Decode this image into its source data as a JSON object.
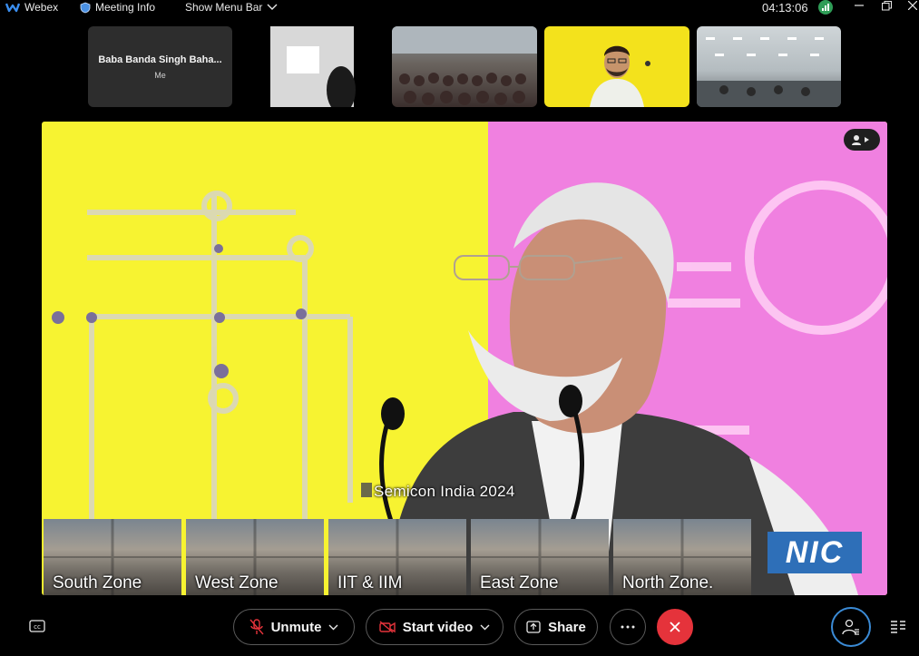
{
  "topbar": {
    "app_name": "Webex",
    "meeting_info_label": "Meeting Info",
    "menu_bar_label": "Show Menu Bar",
    "time": "04:13:06"
  },
  "thumbnails": {
    "me_name": "Baba Banda Singh Baha...",
    "me_sub": "Me"
  },
  "stage": {
    "caption": "Semicon India 2024",
    "logo_text": "NIC",
    "zones": [
      "South Zone",
      "West Zone",
      "IIT & IIM",
      "East Zone",
      "North Zone."
    ]
  },
  "controls": {
    "unmute_label": "Unmute",
    "video_label": "Start video",
    "share_label": "Share"
  },
  "colors": {
    "accent": "#3b8bd6",
    "leave": "#e5333b",
    "stage_yellow": "#f7f331",
    "stage_pink": "#f080e0"
  }
}
